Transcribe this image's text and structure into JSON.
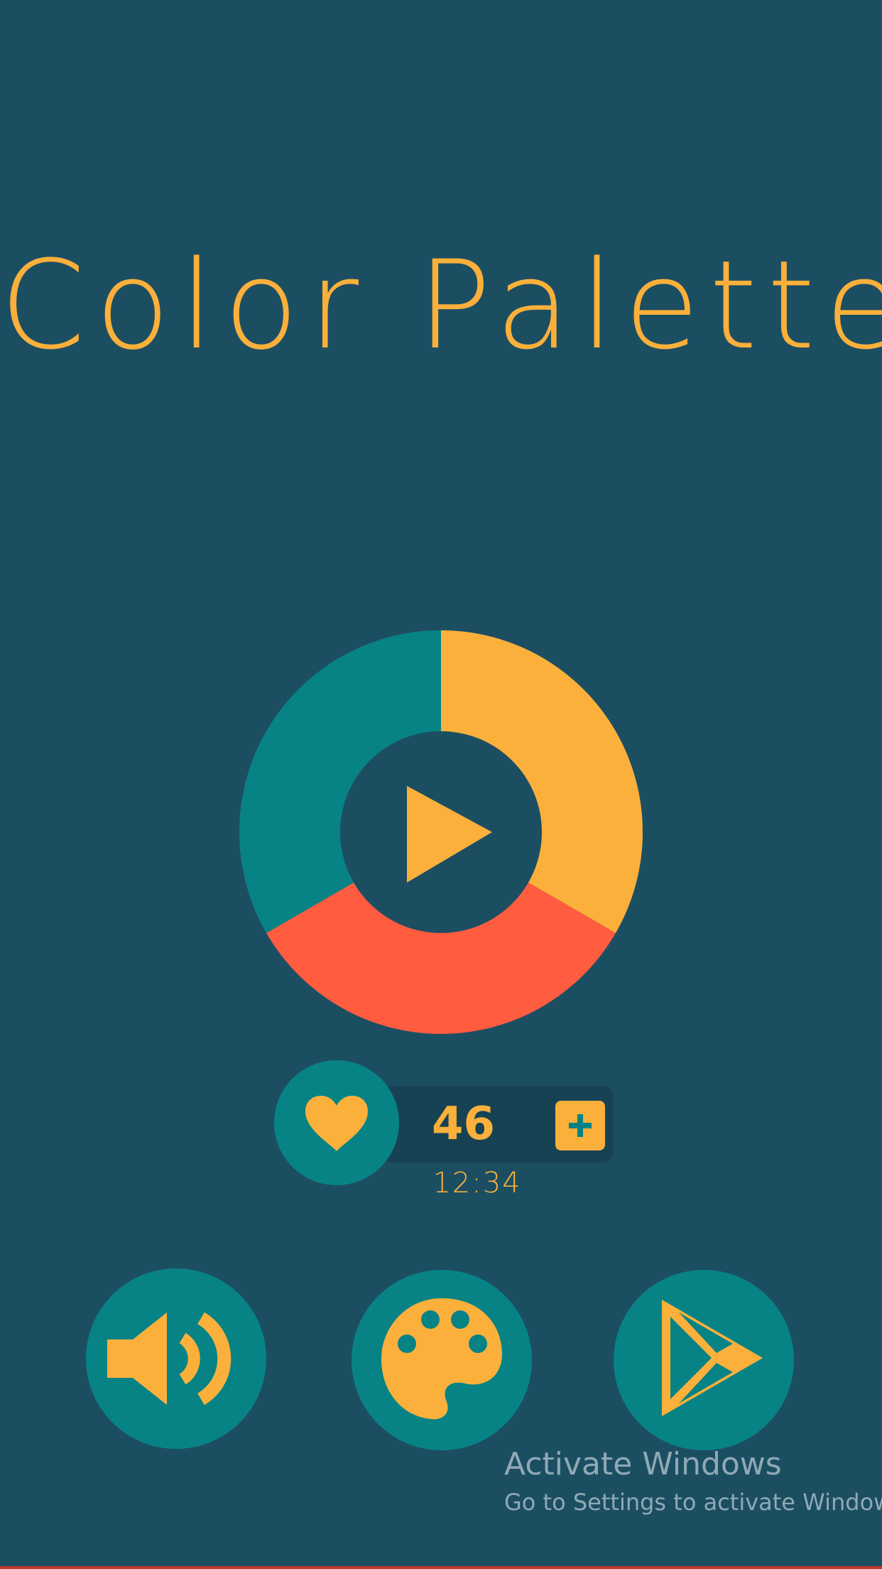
{
  "app": {
    "title": "Color Palette"
  },
  "wheel": {
    "segments": [
      {
        "name": "yellow",
        "color": "#fbb03b"
      },
      {
        "name": "red",
        "color": "#ff5c40"
      },
      {
        "name": "teal",
        "color": "#088385"
      }
    ],
    "center_icon": "play-icon"
  },
  "lives": {
    "icon": "heart-icon",
    "count": "46",
    "add_icon": "plus-icon",
    "timer": "12:34"
  },
  "buttons": [
    {
      "name": "sound-button",
      "icon": "speaker-icon"
    },
    {
      "name": "palette-button",
      "icon": "palette-icon"
    },
    {
      "name": "store-button",
      "icon": "play-store-icon"
    }
  ],
  "watermark": {
    "line1": "Activate Windows",
    "line2": "Go to Settings to activate Windows."
  },
  "colors": {
    "background": "#1c4e62",
    "accent": "#fbb03b",
    "teal": "#088385",
    "red": "#ff5c40"
  }
}
